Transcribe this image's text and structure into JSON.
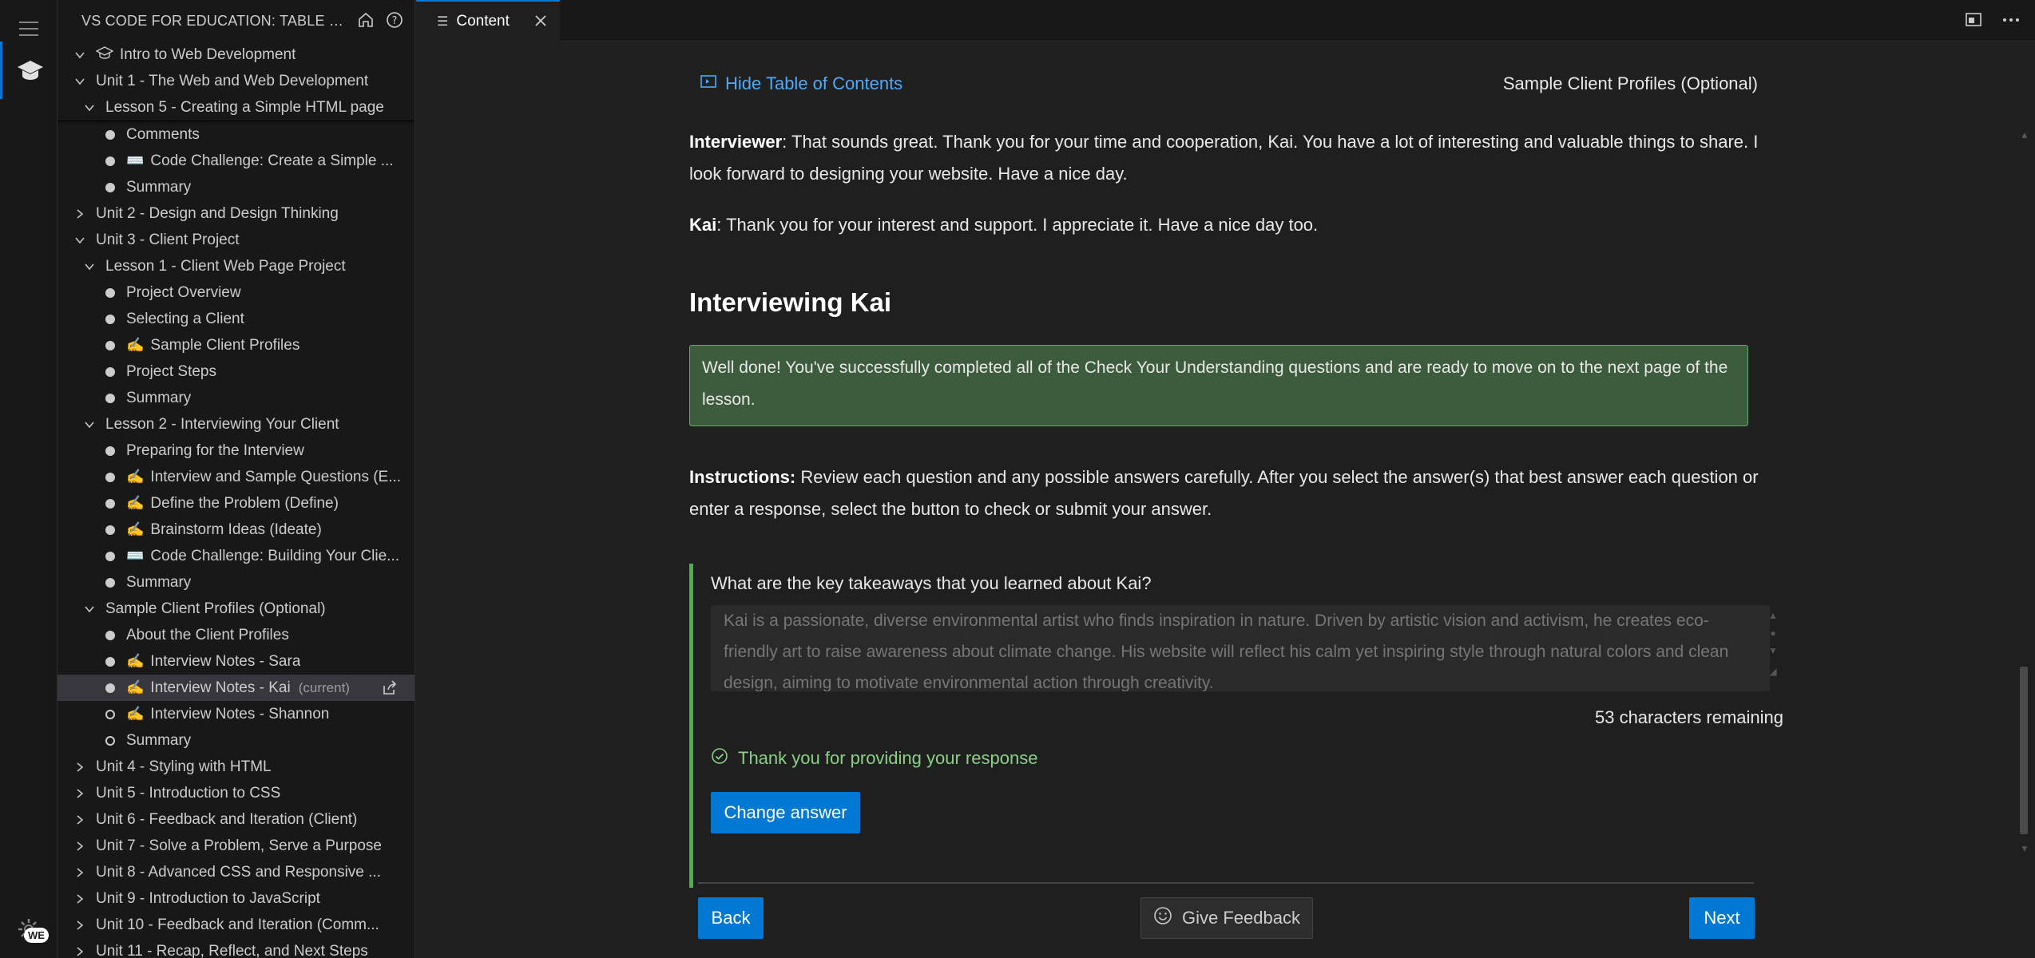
{
  "window": {
    "sidebar_title": "VS CODE FOR EDUCATION: TABLE OF CON...",
    "tab_label": "Content"
  },
  "tree": [
    {
      "label": "Intro to Web Development",
      "level": 0,
      "type": "root",
      "icon": "graduation-cap-icon"
    },
    {
      "label": "Unit 1 - The Web and Web Development",
      "level": 1,
      "type": "expanded"
    },
    {
      "label": "Lesson 5 - Creating a Simple HTML page",
      "level": 2,
      "type": "expanded"
    },
    {
      "label": "Comments",
      "level": 3,
      "type": "item"
    },
    {
      "label": "Code Challenge: Create a Simple ...",
      "level": 3,
      "type": "item",
      "icon": "⌨️"
    },
    {
      "label": "Summary",
      "level": 3,
      "type": "item"
    },
    {
      "label": "Unit 2 - Design and Design Thinking",
      "level": 1,
      "type": "collapsed"
    },
    {
      "label": "Unit 3 - Client Project",
      "level": 1,
      "type": "expanded"
    },
    {
      "label": "Lesson 1 - Client Web Page Project",
      "level": 2,
      "type": "expanded"
    },
    {
      "label": "Project Overview",
      "level": 3,
      "type": "item"
    },
    {
      "label": "Selecting a Client",
      "level": 3,
      "type": "item"
    },
    {
      "label": "Sample Client Profiles",
      "level": 3,
      "type": "item",
      "icon": "✍️"
    },
    {
      "label": "Project Steps",
      "level": 3,
      "type": "item"
    },
    {
      "label": "Summary",
      "level": 3,
      "type": "item"
    },
    {
      "label": "Lesson 2 - Interviewing Your Client",
      "level": 2,
      "type": "expanded"
    },
    {
      "label": "Preparing for the Interview",
      "level": 3,
      "type": "item"
    },
    {
      "label": "Interview and Sample Questions (E...",
      "level": 3,
      "type": "item",
      "icon": "✍️"
    },
    {
      "label": "Define the Problem (Define)",
      "level": 3,
      "type": "item",
      "icon": "✍️"
    },
    {
      "label": "Brainstorm Ideas (Ideate)",
      "level": 3,
      "type": "item",
      "icon": "✍️"
    },
    {
      "label": "Code Challenge: Building Your Clie...",
      "level": 3,
      "type": "item",
      "icon": "⌨️"
    },
    {
      "label": "Summary",
      "level": 3,
      "type": "item"
    },
    {
      "label": "Sample Client Profiles (Optional)",
      "level": 2,
      "type": "expanded"
    },
    {
      "label": "About the Client Profiles",
      "level": 3,
      "type": "item"
    },
    {
      "label": "Interview Notes - Sara",
      "level": 3,
      "type": "item",
      "icon": "✍️"
    },
    {
      "label": "Interview Notes - Kai",
      "level": 3,
      "type": "item",
      "icon": "✍️",
      "selected": true,
      "suffix": "(current)"
    },
    {
      "label": "Interview Notes - Shannon",
      "level": 3,
      "type": "item-hollow",
      "icon": "✍️"
    },
    {
      "label": "Summary",
      "level": 3,
      "type": "item-hollow"
    },
    {
      "label": "Unit 4 - Styling with HTML",
      "level": 1,
      "type": "collapsed"
    },
    {
      "label": "Unit 5 - Introduction to CSS",
      "level": 1,
      "type": "collapsed"
    },
    {
      "label": "Unit 6 - Feedback and Iteration (Client)",
      "level": 1,
      "type": "collapsed"
    },
    {
      "label": "Unit 7 - Solve a Problem, Serve a Purpose",
      "level": 1,
      "type": "collapsed"
    },
    {
      "label": "Unit 8 - Advanced CSS and Responsive ...",
      "level": 1,
      "type": "collapsed"
    },
    {
      "label": "Unit 9 - Introduction to JavaScript",
      "level": 1,
      "type": "collapsed"
    },
    {
      "label": "Unit 10 - Feedback and Iteration (Comm...",
      "level": 1,
      "type": "collapsed"
    },
    {
      "label": "Unit 11 - Recap, Reflect, and Next Steps",
      "level": 1,
      "type": "collapsed"
    }
  ],
  "content": {
    "toc_link": "Hide Table of Contents",
    "page_name": "Sample Client Profiles (Optional)",
    "p1_speaker": "Interviewer",
    "p1_text": ": That sounds great. Thank you for your time and cooperation, Kai. You have a lot of interesting and valuable things to share. I look forward to designing your website. Have a nice day.",
    "p2_speaker": "Kai",
    "p2_text": ": Thank you for your interest and support. I appreciate it. Have a nice day too.",
    "heading": "Interviewing Kai",
    "success_msg": "Well done! You've successfully completed all of the Check Your Understanding questions and are ready to move on to the next page of the lesson.",
    "instr_label": "Instructions:",
    "instr_text": " Review each question and any possible answers carefully. After you select the answer(s) that best answer each question or enter a response, select the button to check or submit your answer.",
    "question": "What are the key takeaways that you learned about Kai?",
    "answer": "Kai is a passionate, diverse environmental artist who finds inspiration in nature. Driven by artistic vision and activism, he creates eco-friendly art to raise awareness about climate change. His website will reflect his calm yet inspiring style through natural colors and clean design, aiming to motivate environmental action through creativity.",
    "remaining": "53 characters remaining",
    "thanks": "Thank you for providing your response",
    "change_btn": "Change answer",
    "back_btn": "Back",
    "feedback_btn": "Give Feedback",
    "next_btn": "Next"
  }
}
